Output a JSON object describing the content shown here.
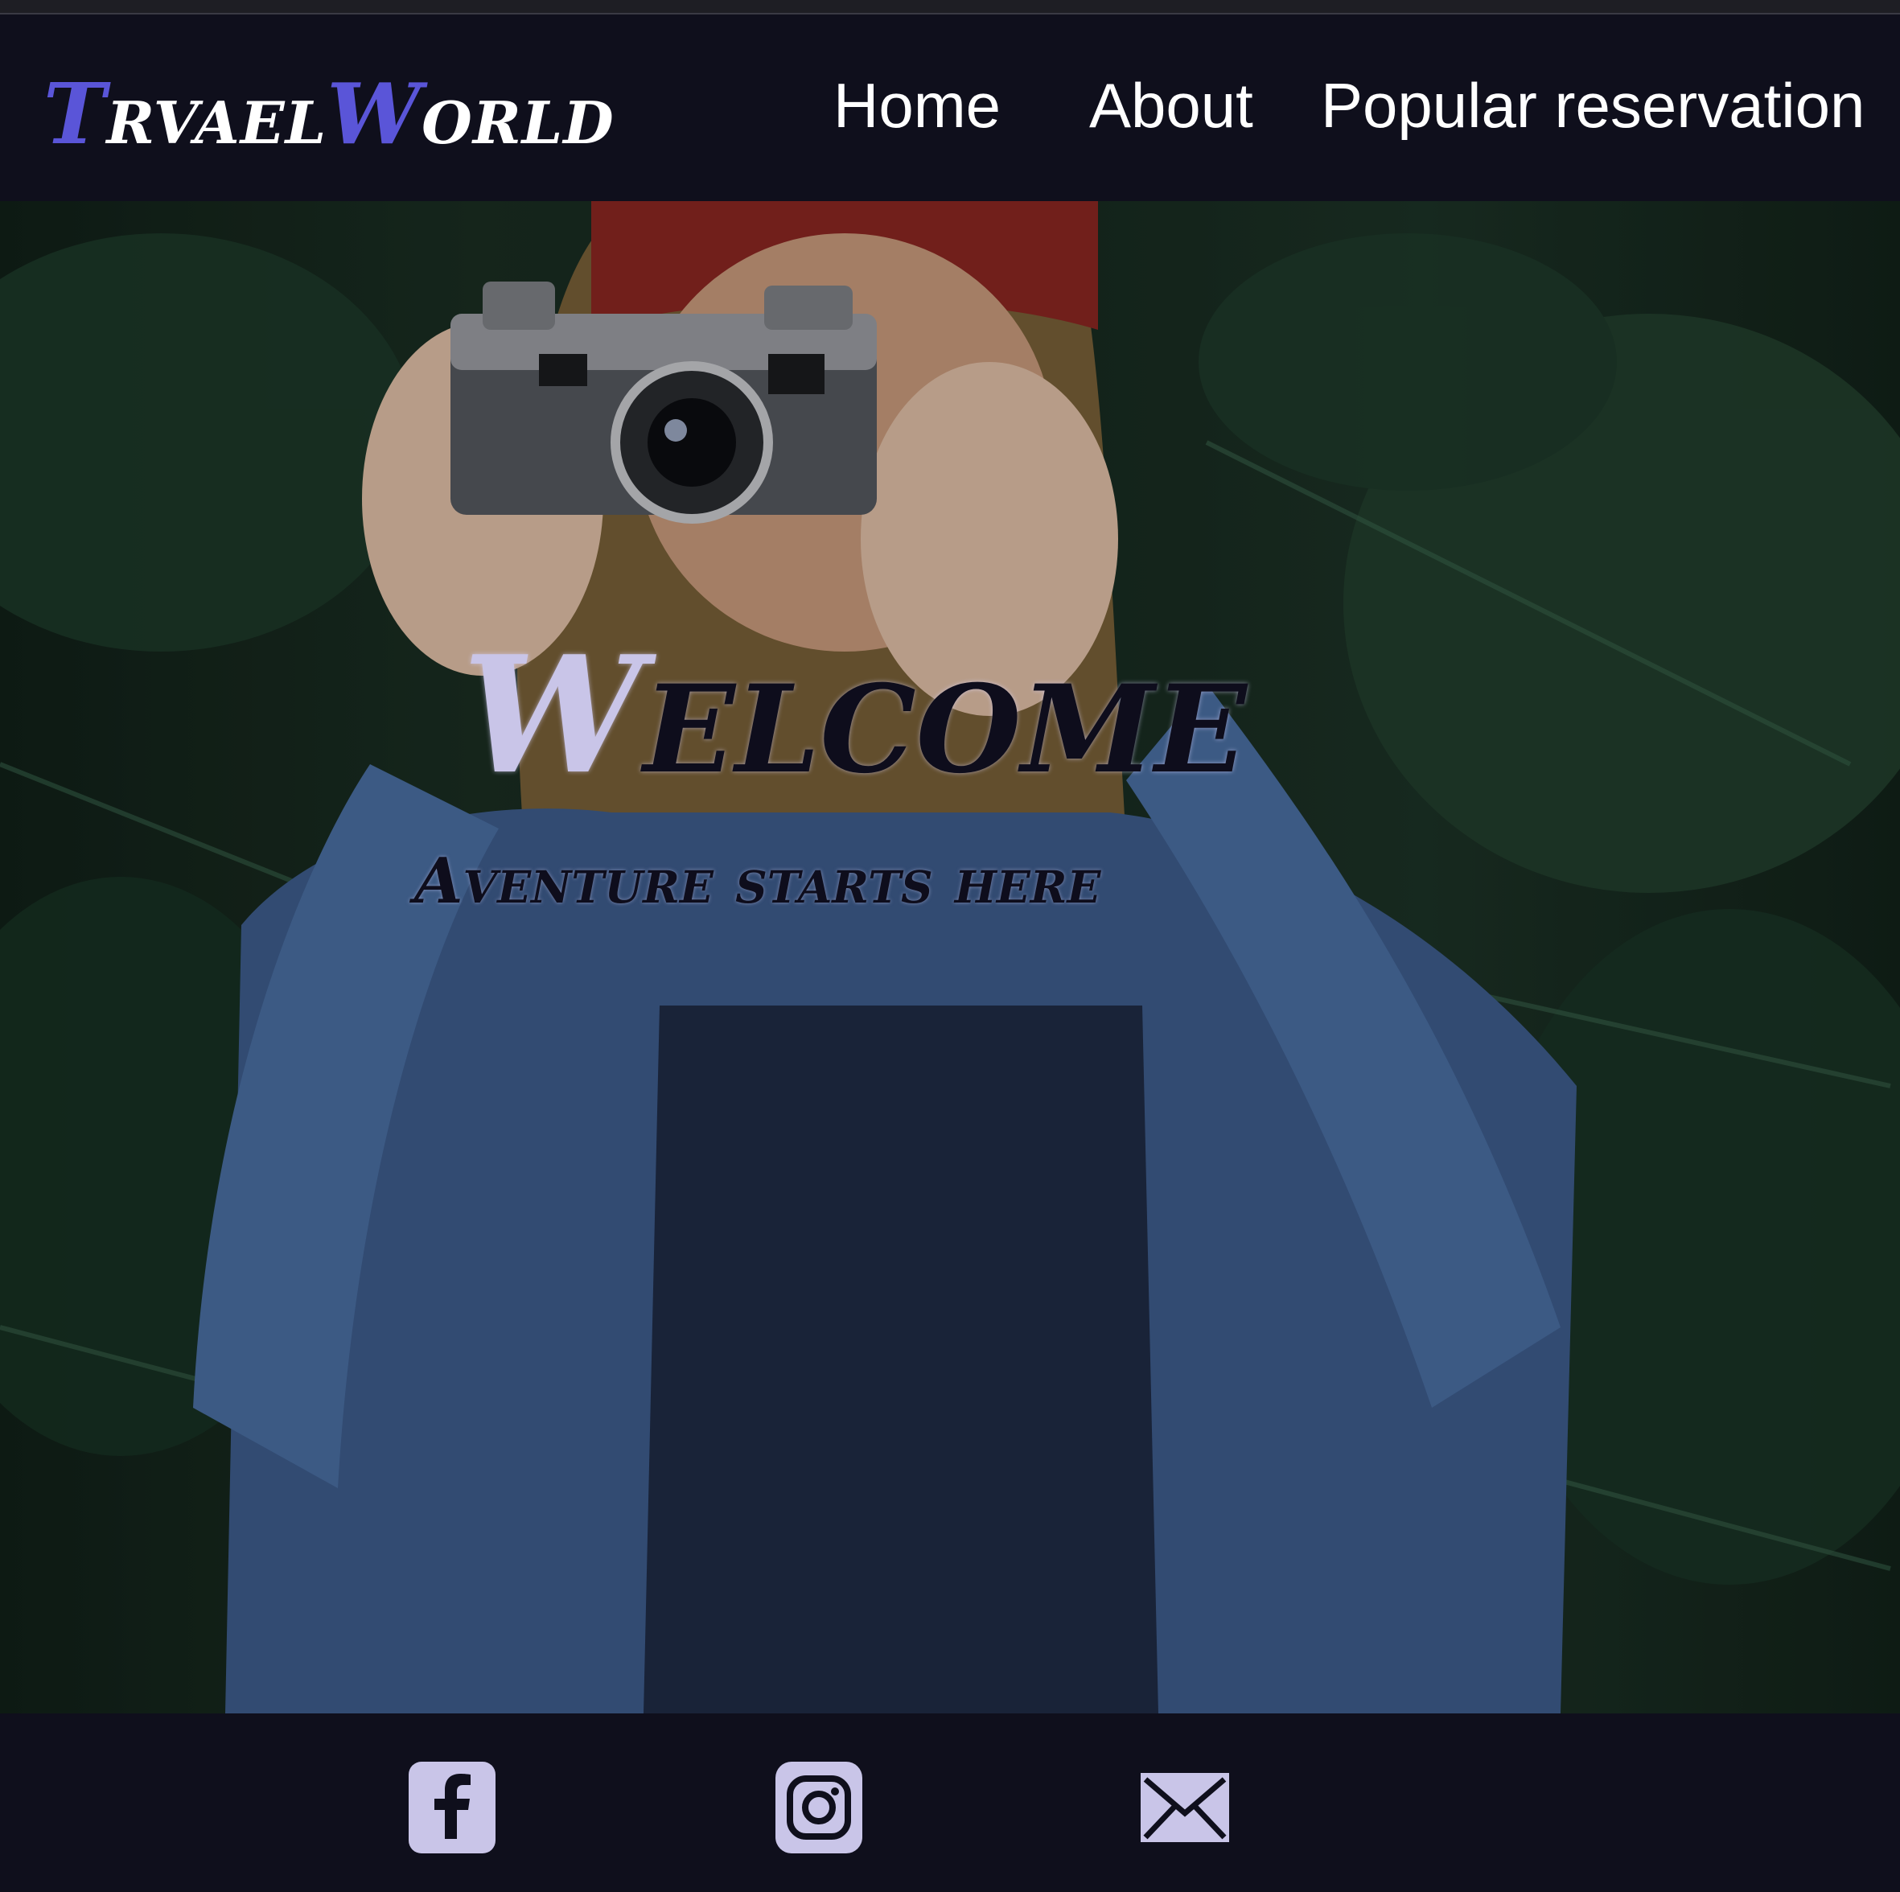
{
  "header": {
    "logo": {
      "part1_initial": "T",
      "part1_rest": "rvael",
      "part2_initial": "W",
      "part2_rest": "orld"
    },
    "nav": {
      "home": "Home",
      "about": "About",
      "popular": "Popular reservation"
    }
  },
  "hero": {
    "welcome_initial": "W",
    "welcome_rest": "elcome",
    "tagline": "Aventure starts here"
  },
  "footer": {
    "icons": [
      "facebook-icon",
      "instagram-icon",
      "mail-icon"
    ]
  },
  "colors": {
    "background": "#0f0f1c",
    "accent": "#5a55d8",
    "icon_fill": "#c9c5e8",
    "heading_text": "#0e0d1c"
  }
}
